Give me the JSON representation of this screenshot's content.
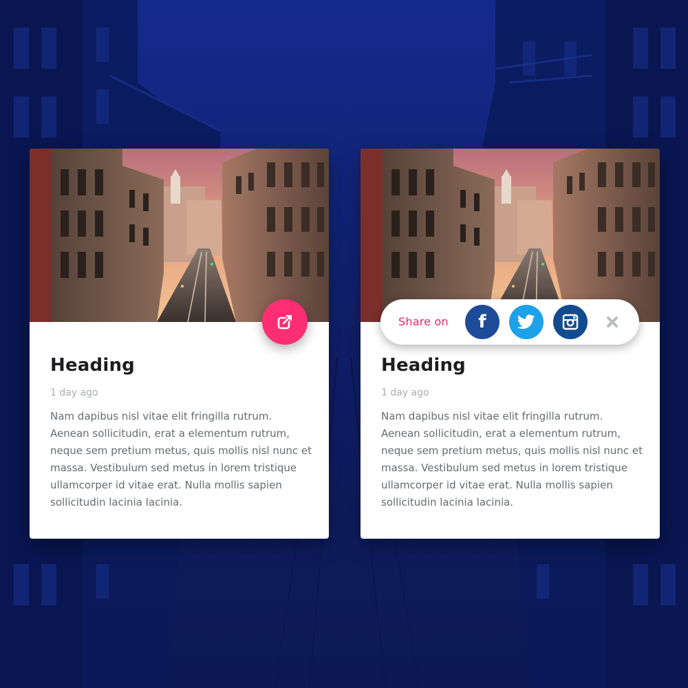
{
  "cards": [
    {
      "heading": "Heading",
      "timestamp": "1 day ago",
      "body": "Nam dapibus nisl vitae elit fringilla rutrum. Aenean sollicitudin, erat a elementum rutrum, neque sem pretium metus, quis mollis nisl nunc et massa. Vestibulum sed metus in lorem tristique ullamcorper id vitae erat. Nulla mollis sapien sollicitudin lacinia lacinia.",
      "action_icon": "share-icon"
    },
    {
      "heading": "Heading",
      "timestamp": "1 day ago",
      "body": "Nam dapibus nisl vitae elit fringilla rutrum. Aenean sollicitudin, erat a elementum rutrum, neque sem pretium metus, quis mollis nisl nunc et massa. Vestibulum sed metus in lorem tristique ullamcorper id vitae erat. Nulla mollis sapien sollicitudin lacinia lacinia.",
      "share_bar": {
        "label": "Share on",
        "networks": [
          {
            "name": "facebook",
            "icon": "facebook-icon",
            "glyph": "f",
            "color": "#1f4c99"
          },
          {
            "name": "twitter",
            "icon": "twitter-icon",
            "color": "#1da1e8"
          },
          {
            "name": "instagram",
            "icon": "instagram-icon",
            "color": "#134c8e"
          }
        ],
        "close_icon": "close-icon"
      }
    }
  ],
  "colors": {
    "background": "#10206e",
    "accent_pink": "#ff2e74",
    "share_label": "#e8246b",
    "heading": "#1d1d1f",
    "timestamp": "#a9acb3",
    "body_text": "#666a72"
  }
}
